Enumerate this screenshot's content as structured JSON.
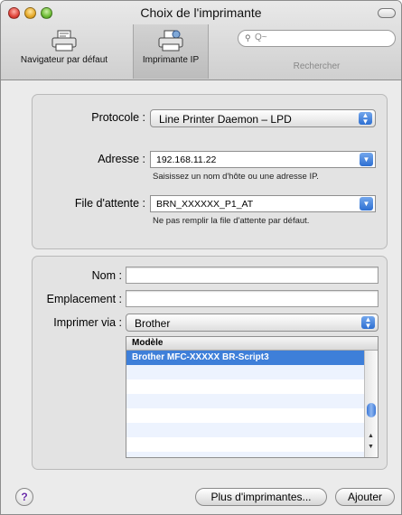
{
  "window": {
    "title": "Choix de l'imprimante"
  },
  "toolbar": {
    "default_browser_label": "Navigateur par défaut",
    "ip_printer_label": "Imprimante IP",
    "search_placeholder": "Q~",
    "search_label": "Rechercher"
  },
  "connection": {
    "protocol_label": "Protocole :",
    "protocol_value": "Line Printer Daemon – LPD",
    "address_label": "Adresse :",
    "address_value": "192.168.11.22",
    "address_hint": "Saisissez un nom d'hôte ou une adresse IP.",
    "queue_label": "File d'attente :",
    "queue_value": "BRN_XXXXXX_P1_AT",
    "queue_hint": "Ne pas remplir la file d'attente par défaut."
  },
  "details": {
    "name_label": "Nom :",
    "name_value": "",
    "location_label": "Emplacement :",
    "location_value": "",
    "print_via_label": "Imprimer via :",
    "print_via_value": "Brother",
    "model_header": "Modèle",
    "models": [
      "Brother MFC-XXXXX BR-Script3",
      "",
      "",
      "",
      "",
      "",
      "",
      ""
    ]
  },
  "footer": {
    "help_label": "?",
    "more_printers_label": "Plus d'imprimantes...",
    "add_label": "Ajouter"
  },
  "colors": {
    "selection": "#3e7fd9",
    "accent": "#2d6fd2"
  }
}
